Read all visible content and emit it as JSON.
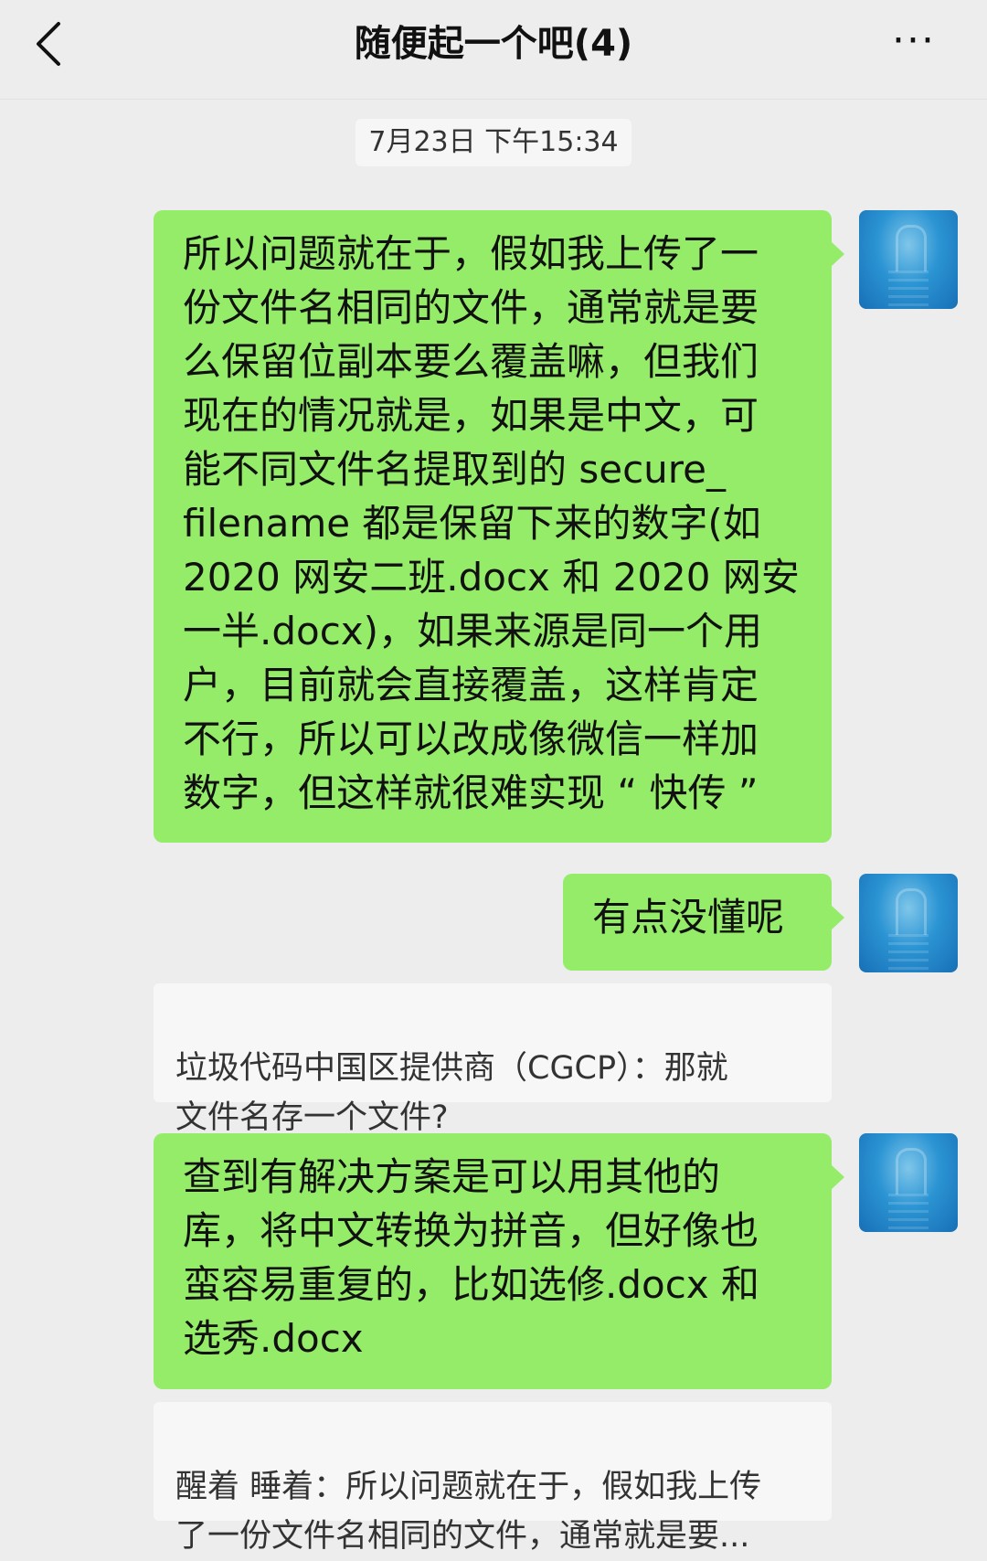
{
  "header": {
    "title": "随便起一个吧(4)",
    "back_icon": "chevron-left-icon",
    "more_icon": "more-dots-icon",
    "more_label": "···"
  },
  "timestamp": "7月23日 下午15:34",
  "messages": [
    {
      "type": "outgoing",
      "text": "所以问题就在于，假如我上传了一\n份文件名相同的文件，通常就是要\n么保留位副本要么覆盖嘛，但我们\n现在的情况就是，如果是中文，可\n能不同文件名提取到的 secure_\nfilename 都是保留下来的数字(如\n2020 网安二班.docx 和 2020 网安\n一半.docx)，如果来源是同一个用\n户，目前就会直接覆盖，这样肯定\n不行，所以可以改成像微信一样加\n数字，但这样就很难实现 “ 快传 ”"
    },
    {
      "type": "outgoing",
      "text": "有点没懂呢"
    },
    {
      "type": "quote",
      "text": "垃圾代码中国区提供商（CGCP）：那就\n文件名存一个文件?"
    },
    {
      "type": "outgoing",
      "text": "查到有解决方案是可以用其他的\n库，将中文转换为拼音，但好像也\n蛮容易重复的，比如选修.docx 和\n选秀.docx"
    },
    {
      "type": "quote",
      "text": "醒着 睡着：所以问题就在于，假如我上传\n了一份文件名相同的文件，通常就是要..."
    }
  ],
  "colors": {
    "background": "#ededed",
    "outgoing_bubble": "#95ec69",
    "quote_bubble": "#f7f7f7",
    "avatar": "#2b94d3"
  }
}
